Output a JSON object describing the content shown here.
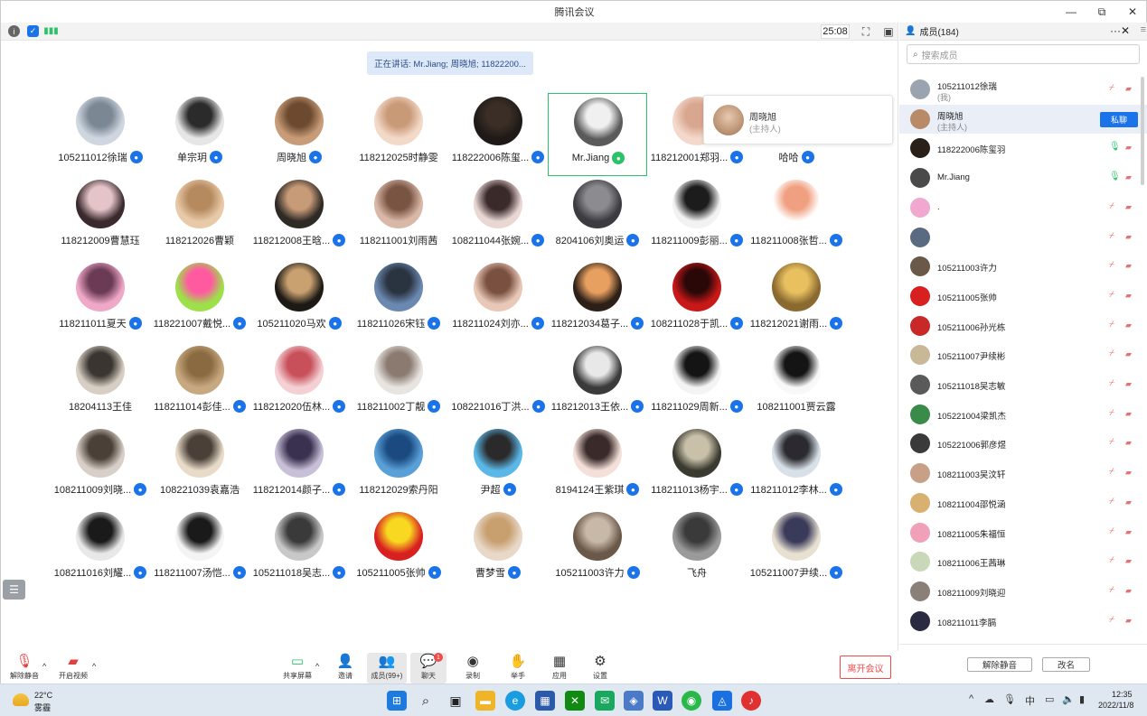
{
  "window": {
    "title": "腾讯会议"
  },
  "status": {
    "timer": "25:08"
  },
  "speaking": {
    "text": "正在讲话: Mr.Jiang; 周晓旭; 11822200..."
  },
  "popover": {
    "name": "周晓旭",
    "role": "(主持人)"
  },
  "grid": [
    {
      "name": "105211012徐瑞",
      "mic": true,
      "bg": "#cfd6e0",
      "fg": "#7b8794"
    },
    {
      "name": "单宗玥",
      "mic": true,
      "bg": "#e6e6e6",
      "fg": "#2b2b2b"
    },
    {
      "name": "周晓旭",
      "mic": true,
      "bg": "#c89c78",
      "fg": "#6b4a30"
    },
    {
      "name": "118212025时静雯",
      "mic": false,
      "bg": "#f3d9c8",
      "fg": "#c99a78"
    },
    {
      "name": "118222006陈玺...",
      "mic": true,
      "bg": "#1f1a17",
      "fg": "#3a2e26"
    },
    {
      "name": "Mr.Jiang",
      "mic": true,
      "bg": "#5a5a5a",
      "fg": "#f0f0f0",
      "active": true
    },
    {
      "name": "118212001郑羽...",
      "mic": true,
      "bg": "#f4d8cc",
      "fg": "#d9a790"
    },
    {
      "name": "哈哈",
      "mic": true,
      "bg": "#ffffff",
      "fg": "#ffffff"
    },
    {
      "name": "118212009曹慧珏",
      "mic": false,
      "bg": "#3a2a2e",
      "fg": "#e4c4c8"
    },
    {
      "name": "118212026曹颖",
      "mic": false,
      "bg": "#e8c9a8",
      "fg": "#b58a5e"
    },
    {
      "name": "118212008王晗...",
      "mic": true,
      "bg": "#2e2a26",
      "fg": "#c89b78"
    },
    {
      "name": "118211001刘雨茜",
      "mic": false,
      "bg": "#d9b8a8",
      "fg": "#7a5443"
    },
    {
      "name": "108211044张婉...",
      "mic": true,
      "bg": "#e9d7d4",
      "fg": "#3a2a2a"
    },
    {
      "name": "8204106刘奥运",
      "mic": true,
      "bg": "#3b3b40",
      "fg": "#8b8b90"
    },
    {
      "name": "118211009彭丽...",
      "mic": true,
      "bg": "#f2f2f2",
      "fg": "#1c1c1c"
    },
    {
      "name": "118211008张哲...",
      "mic": true,
      "bg": "#ffffff",
      "fg": "#f0a080"
    },
    {
      "name": "118211011夏天",
      "mic": true,
      "bg": "#f0a8c8",
      "fg": "#6b3a55"
    },
    {
      "name": "118221007戴悦...",
      "mic": true,
      "bg": "#9ee04a",
      "fg": "#ff5aa0"
    },
    {
      "name": "105211020马欢",
      "mic": true,
      "bg": "#1d1a16",
      "fg": "#c9a070"
    },
    {
      "name": "118211026宋钰",
      "mic": true,
      "bg": "#6a88b0",
      "fg": "#2a3340"
    },
    {
      "name": "118211024刘亦...",
      "mic": true,
      "bg": "#e9c8b8",
      "fg": "#7a5040"
    },
    {
      "name": "118212034葛子...",
      "mic": true,
      "bg": "#2c2018",
      "fg": "#e8a060"
    },
    {
      "name": "108211028于凯...",
      "mic": true,
      "bg": "#c81818",
      "fg": "#2a0808"
    },
    {
      "name": "118212021谢雨...",
      "mic": true,
      "bg": "#8a6a30",
      "fg": "#e8c060"
    },
    {
      "name": "18204113王佳",
      "mic": false,
      "bg": "#d8cfc4",
      "fg": "#3a3530"
    },
    {
      "name": "118211014彭佳...",
      "mic": true,
      "bg": "#c8a880",
      "fg": "#8a6a40"
    },
    {
      "name": "118212020伍林...",
      "mic": true,
      "bg": "#f4d0d4",
      "fg": "#c8505a"
    },
    {
      "name": "118211002丁靓",
      "mic": true,
      "bg": "#e8e4e0",
      "fg": "#8a7a70"
    },
    {
      "name": "108221016丁洪...",
      "mic": true,
      "bg": "#ffffff",
      "fg": "#ffffff"
    },
    {
      "name": "118212013王依...",
      "mic": true,
      "bg": "#3a3a3a",
      "fg": "#e8e8e8"
    },
    {
      "name": "118211029周新...",
      "mic": true,
      "bg": "#f4f4f4",
      "fg": "#141414"
    },
    {
      "name": "108211001贾云露",
      "mic": false,
      "bg": "#f8f8f8",
      "fg": "#141414"
    },
    {
      "name": "108211009刘晓...",
      "mic": true,
      "bg": "#d8d0c8",
      "fg": "#4a4038"
    },
    {
      "name": "108221039袁嘉浩",
      "mic": false,
      "bg": "#e8dcc8",
      "fg": "#4a4038"
    },
    {
      "name": "118212014颜子...",
      "mic": true,
      "bg": "#c8c0d8",
      "fg": "#3a3050"
    },
    {
      "name": "118212029索丹阳",
      "mic": false,
      "bg": "#5aa0d8",
      "fg": "#1a4a80"
    },
    {
      "name": "尹超",
      "mic": true,
      "bg": "#5ab8e8",
      "fg": "#2a2a2a"
    },
    {
      "name": "8194124王紫琪",
      "mic": true,
      "bg": "#f4e0d8",
      "fg": "#3a2a2a"
    },
    {
      "name": "118211013杨宇...",
      "mic": true,
      "bg": "#3a3a30",
      "fg": "#c8c0a8"
    },
    {
      "name": "118211012李林...",
      "mic": true,
      "bg": "#d8e0e8",
      "fg": "#2a2a30"
    },
    {
      "name": "108211016刘耀...",
      "mic": true,
      "bg": "#e8e8e8",
      "fg": "#1a1a1a"
    },
    {
      "name": "118211007汤恺...",
      "mic": true,
      "bg": "#f4f4f4",
      "fg": "#1a1a1a"
    },
    {
      "name": "105211018吴志...",
      "mic": true,
      "bg": "#c8c8c8",
      "fg": "#3a3a3a"
    },
    {
      "name": "105211005张帅",
      "mic": true,
      "bg": "#d82020",
      "fg": "#f8d820"
    },
    {
      "name": "曹梦雪",
      "mic": true,
      "bg": "#e8d8c8",
      "fg": "#c8a070"
    },
    {
      "name": "105211003许力",
      "mic": true,
      "bg": "#6a5848",
      "fg": "#c8b8a8"
    },
    {
      "name": "飞舟",
      "mic": false,
      "bg": "#9a9a9a",
      "fg": "#3a3a3a"
    },
    {
      "name": "105211007尹续...",
      "mic": true,
      "bg": "#e8e0d0",
      "fg": "#3a3a5a"
    }
  ],
  "toolbar": {
    "unmute": "解除静音",
    "video": "开启视频",
    "share": "共享屏幕",
    "invite": "邀请",
    "members": "成员(99+)",
    "chat": "聊天",
    "chat_badge": "1",
    "record": "录制",
    "raise": "举手",
    "apps": "应用",
    "settings": "设置",
    "leave": "离开会议"
  },
  "panel": {
    "title": "成员(184)",
    "search_placeholder": "搜索成员",
    "dm_label": "私聊",
    "unmute_all": "解除静音",
    "rename": "改名",
    "members": [
      {
        "name": "105211012徐瑞",
        "sub": "(我)",
        "mic": "off",
        "color": "#9aa4b0"
      },
      {
        "name": "周晓旭",
        "sub": "(主持人)",
        "mic": "off",
        "color": "#b88a68",
        "selected": true
      },
      {
        "name": "118222006陈玺羽",
        "sub": "",
        "mic": "on",
        "color": "#2a201a"
      },
      {
        "name": "Mr.Jiang",
        "sub": "",
        "mic": "on",
        "color": "#4a4a4a"
      },
      {
        "name": ".",
        "sub": "",
        "mic": "off",
        "color": "#f0a8d0"
      },
      {
        "name": "",
        "sub": "",
        "mic": "off",
        "color": "#5a6a80"
      },
      {
        "name": "105211003许力",
        "sub": "",
        "mic": "off",
        "color": "#6a5848"
      },
      {
        "name": "105211005张帅",
        "sub": "",
        "mic": "off",
        "color": "#d82020"
      },
      {
        "name": "105211006孙光栋",
        "sub": "",
        "mic": "off",
        "color": "#c82828"
      },
      {
        "name": "105211007尹续彬",
        "sub": "",
        "mic": "off",
        "color": "#c8b898"
      },
      {
        "name": "105211018吴志敏",
        "sub": "",
        "mic": "off",
        "color": "#5a5a5a"
      },
      {
        "name": "105221004梁凯杰",
        "sub": "",
        "mic": "off",
        "color": "#3a8a4a"
      },
      {
        "name": "105221006郭彦煜",
        "sub": "",
        "mic": "off",
        "color": "#3a3a3a"
      },
      {
        "name": "108211003吴汶轩",
        "sub": "",
        "mic": "off",
        "color": "#c8a088"
      },
      {
        "name": "108211004邵悦涵",
        "sub": "",
        "mic": "off",
        "color": "#d8b070"
      },
      {
        "name": "108211005朱福恒",
        "sub": "",
        "mic": "off",
        "color": "#f0a0b8"
      },
      {
        "name": "108211006王茜琳",
        "sub": "",
        "mic": "off",
        "color": "#c8d8b8"
      },
      {
        "name": "108211009刘晓迎",
        "sub": "",
        "mic": "off",
        "color": "#8a8078"
      },
      {
        "name": "108211011李膈",
        "sub": "",
        "mic": "off",
        "color": "#2a2a40"
      }
    ]
  },
  "taskbar": {
    "temp": "22°C",
    "weather": "雾霾",
    "ime": "中",
    "time": "12:35",
    "date": "2022/11/8"
  }
}
